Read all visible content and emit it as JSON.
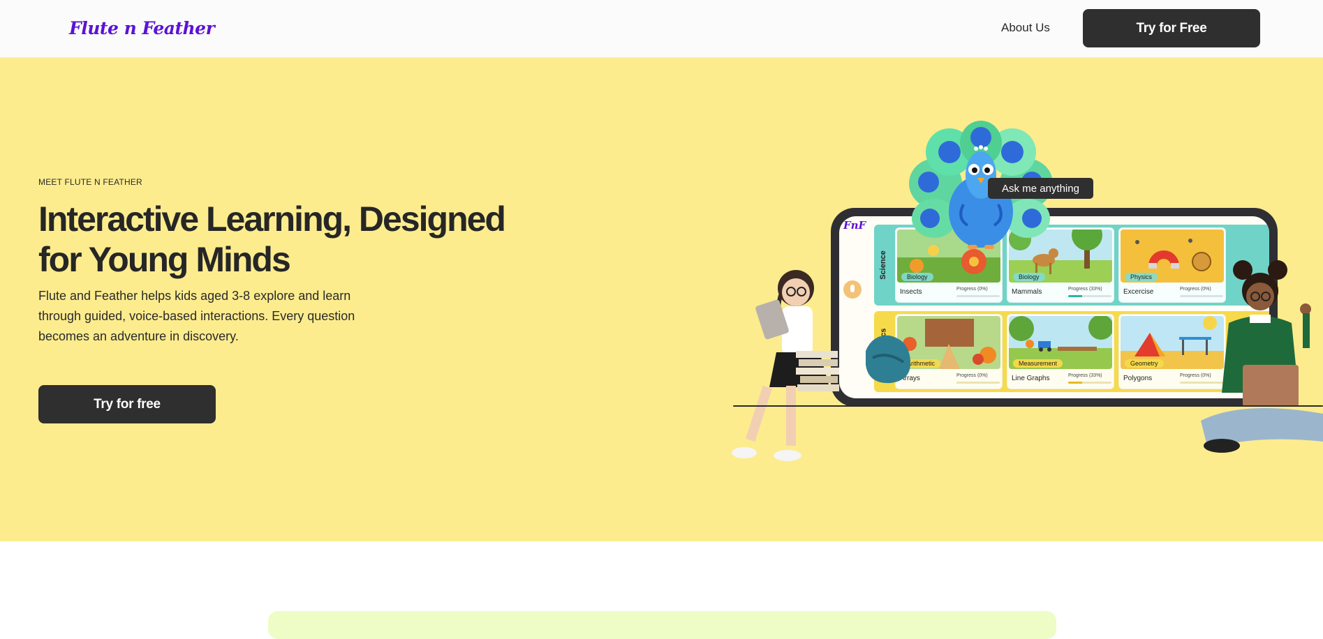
{
  "header": {
    "logo_text": "Flute n Feather",
    "nav_about": "About Us",
    "cta": "Try for Free"
  },
  "hero": {
    "eyebrow": "MEET FLUTE N FEATHER",
    "headline": "Interactive Learning, Designed for Young Minds",
    "subtext": "Flute and Feather helps kids aged 3-8 explore and learn through guided, voice-based interactions. Every question becomes an adventure in discovery.",
    "cta": "Try for free"
  },
  "illustration": {
    "tooltip": "Ask me anything",
    "app_logo": "FnF",
    "rows": [
      {
        "label": "Science",
        "cards": [
          {
            "tag": "Biology",
            "title": "Insects",
            "progress": "Progress (0%)",
            "progress_value": 0
          },
          {
            "tag": "Biology",
            "title": "Mammals",
            "progress": "Progress (33%)",
            "progress_value": 33
          },
          {
            "tag": "Physics",
            "title": "Excercise",
            "progress": "Progress (0%)",
            "progress_value": 0
          }
        ]
      },
      {
        "label": "Mathematics",
        "cards": [
          {
            "tag": "Arithmetic",
            "title": "Arrays",
            "progress": "Progress (0%)",
            "progress_value": 0
          },
          {
            "tag": "Measurement",
            "title": "Line Graphs",
            "progress": "Progress (33%)",
            "progress_value": 33
          },
          {
            "tag": "Geometry",
            "title": "Polygons",
            "progress": "Progress (0%)",
            "progress_value": 0
          }
        ]
      }
    ]
  },
  "colors": {
    "hero_bg": "#fcec8e",
    "brand_purple": "#5b12d6",
    "button_dark": "#2f2f2f",
    "science_row": "#6fd3c8",
    "math_row": "#f6da4a",
    "lower_band": "#eefcc6"
  },
  "icons": [
    "microphone-icon"
  ]
}
